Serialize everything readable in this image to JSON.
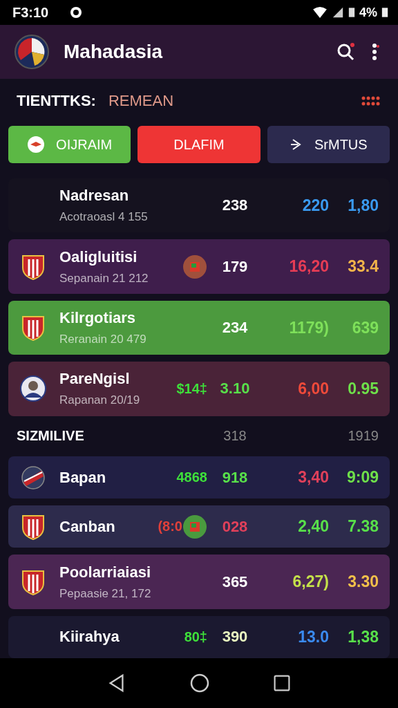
{
  "status_bar": {
    "time": "F3:10",
    "battery": "4%"
  },
  "app_bar": {
    "title": "Mahadasia"
  },
  "filter": {
    "label": "TIENTTKS:",
    "value": "REMEAN"
  },
  "tabs": [
    {
      "label": "OIJRAIM",
      "color": "#5cb845",
      "kind": "emblem"
    },
    {
      "label": "DLAFIM",
      "color": "#ee3535",
      "kind": "plain"
    },
    {
      "label": "SrMTUS",
      "color": "#2c2a4e",
      "kind": "arrow"
    }
  ],
  "groups": [
    {
      "rows": [
        {
          "name": "Nadresan",
          "sub": "Acotraoasl 4 155",
          "kind": "plain",
          "badge": false,
          "color": "#15121f",
          "value": {
            "text": "238",
            "color": "#ffffff"
          },
          "odds": [
            {
              "text": "220",
              "color": "#3a9af0"
            },
            {
              "text": "1,80",
              "color": "#3a9af0"
            }
          ]
        },
        {
          "name": "Oaligluitisi",
          "sub": "Sepanain 21 212",
          "kind": "shield",
          "badge": true,
          "color": "#3f1e4c",
          "value": {
            "text": "179",
            "color": "#ffffff"
          },
          "odds": [
            {
              "text": "16,20",
              "color": "#e63c55"
            },
            {
              "text": "33.4",
              "color": "#f2b44a"
            }
          ]
        },
        {
          "name": "Kilrgotiars",
          "sub": "Reranain 20 479",
          "kind": "shield",
          "badge": false,
          "color": "#4c9a3e",
          "value": {
            "text": "234",
            "color": "#ffffff"
          },
          "odds": [
            {
              "text": "1179)",
              "color": "#7ee05a"
            },
            {
              "text": "639",
              "color": "#7ee05a"
            }
          ]
        },
        {
          "name": "PareNgisl",
          "sub": "Rapanan 20/19",
          "kind": "avatar",
          "badge": false,
          "extra": {
            "text": "$14‡",
            "color": "#3ee03a"
          },
          "color": "#4a2338",
          "value": {
            "text": "3.10",
            "color": "#58e04a"
          },
          "odds": [
            {
              "text": "6,00",
              "color": "#ee4a3a"
            },
            {
              "text": "0.95",
              "color": "#6ee04a"
            }
          ]
        }
      ]
    },
    {
      "header": {
        "label": "SIZMILIVE",
        "value": "318",
        "odd": "1919"
      },
      "rows": [
        {
          "name": "Bapan",
          "kind": "round",
          "badge": false,
          "extra": {
            "text": "4868",
            "color": "#3ee03a"
          },
          "color": "#211f44",
          "value": {
            "text": "918",
            "color": "#58e04a"
          },
          "odds": [
            {
              "text": "3,40",
              "color": "#e0405a"
            },
            {
              "text": "9:09",
              "color": "#6ee04a"
            }
          ]
        },
        {
          "name": "Canban",
          "kind": "shield",
          "badge": true,
          "extra": {
            "text": "(8:0",
            "color": "#e0403a"
          },
          "color": "#2d2b4c",
          "value": {
            "text": "028",
            "color": "#e0405a"
          },
          "odds": [
            {
              "text": "2,40",
              "color": "#58e04a"
            },
            {
              "text": "7.38",
              "color": "#58e04a"
            }
          ]
        },
        {
          "name": "Poolarriaiasi",
          "sub": "Pepaasie 21, 172",
          "kind": "shield",
          "badge": false,
          "color": "#4b2653",
          "value": {
            "text": "365",
            "color": "#ffffff"
          },
          "odds": [
            {
              "text": "6,27)",
              "color": "#c4e04a"
            },
            {
              "text": "3.30",
              "color": "#f2c04a"
            }
          ]
        },
        {
          "name": "Kiirahya",
          "kind": "plain",
          "badge": false,
          "extra": {
            "text": "80‡",
            "color": "#3ee03a"
          },
          "color": "#1b1930",
          "value": {
            "text": "390",
            "color": "#e8f4c0"
          },
          "odds": [
            {
              "text": "13.0",
              "color": "#3a8af0"
            },
            {
              "text": "1,38",
              "color": "#58e04a"
            }
          ]
        }
      ]
    }
  ]
}
